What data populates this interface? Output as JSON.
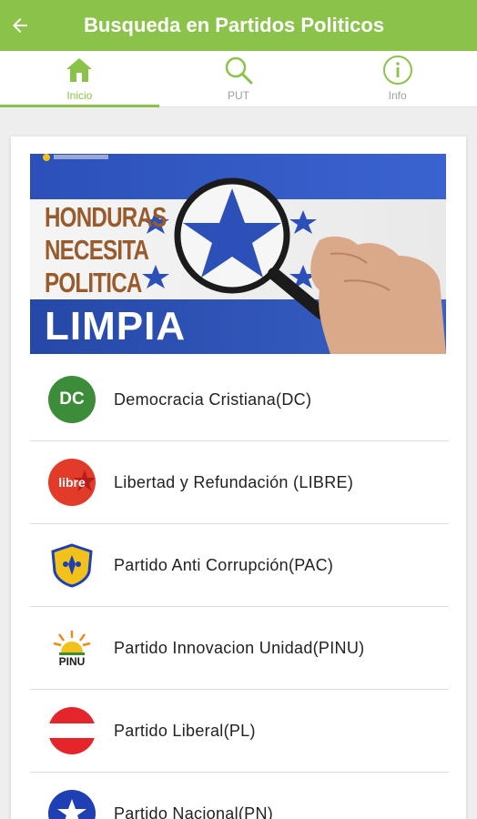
{
  "appbar": {
    "title": "Busqueda en Partidos Politicos",
    "back_icon": "arrow-left-icon"
  },
  "tabs": [
    {
      "label": "Inicio",
      "icon": "home-icon",
      "active": true
    },
    {
      "label": "PUT",
      "icon": "search-icon",
      "active": false
    },
    {
      "label": "Info",
      "icon": "info-icon",
      "active": false
    }
  ],
  "banner": {
    "line1": "HONDURAS",
    "line2": "NECESITA",
    "line3": "POLITICA",
    "line4": "LIMPIA"
  },
  "parties": [
    {
      "name": "Democracia Cristiana(DC)",
      "logo_text": "DC",
      "color": "#3c8c3a"
    },
    {
      "name": "Libertad y Refundación (LIBRE)",
      "logo_text": "libre",
      "color": "#e23b2a"
    },
    {
      "name": "Partido Anti Corrupción(PAC)",
      "logo_text": "",
      "color": "#f2c21a"
    },
    {
      "name": "Partido Innovacion Unidad(PINU)",
      "logo_text": "PINU",
      "color": "#f08a1c"
    },
    {
      "name": "Partido Liberal(PL)",
      "logo_text": "",
      "color": "#e4252b"
    },
    {
      "name": "Partido Nacional(PN)",
      "logo_text": "",
      "color": "#1f3fb4"
    }
  ],
  "colors": {
    "primary": "#8bc34a",
    "text": "#222222"
  }
}
